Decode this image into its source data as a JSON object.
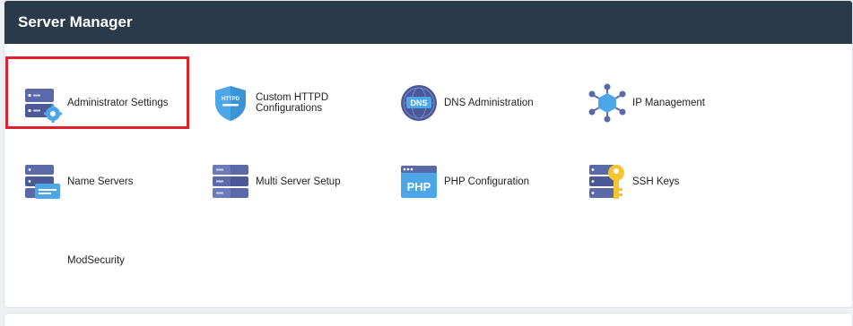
{
  "header": {
    "title": "Server Manager"
  },
  "tiles": [
    {
      "label": "Administrator Settings",
      "icon": "server-gear-icon"
    },
    {
      "label": "Custom HTTPD Configurations",
      "icon": "httpd-shield-icon",
      "badge": "HTTPD"
    },
    {
      "label": "DNS Administration",
      "icon": "dns-globe-icon",
      "badge": "DNS"
    },
    {
      "label": "IP Management",
      "icon": "ip-network-icon"
    },
    {
      "label": "Name Servers",
      "icon": "name-server-icon"
    },
    {
      "label": "Multi Server Setup",
      "icon": "server-stack-icon"
    },
    {
      "label": "PHP Configuration",
      "icon": "php-window-icon",
      "badge": "PHP"
    },
    {
      "label": "SSH Keys",
      "icon": "ssh-key-icon"
    },
    {
      "label": "ModSecurity",
      "icon": ""
    }
  ],
  "colors": {
    "header_bg": "#293a4a",
    "icon_primary": "#5a6aa8",
    "icon_accent": "#4da6e8",
    "key_yellow": "#f5c531",
    "highlight": "#e0202a"
  }
}
